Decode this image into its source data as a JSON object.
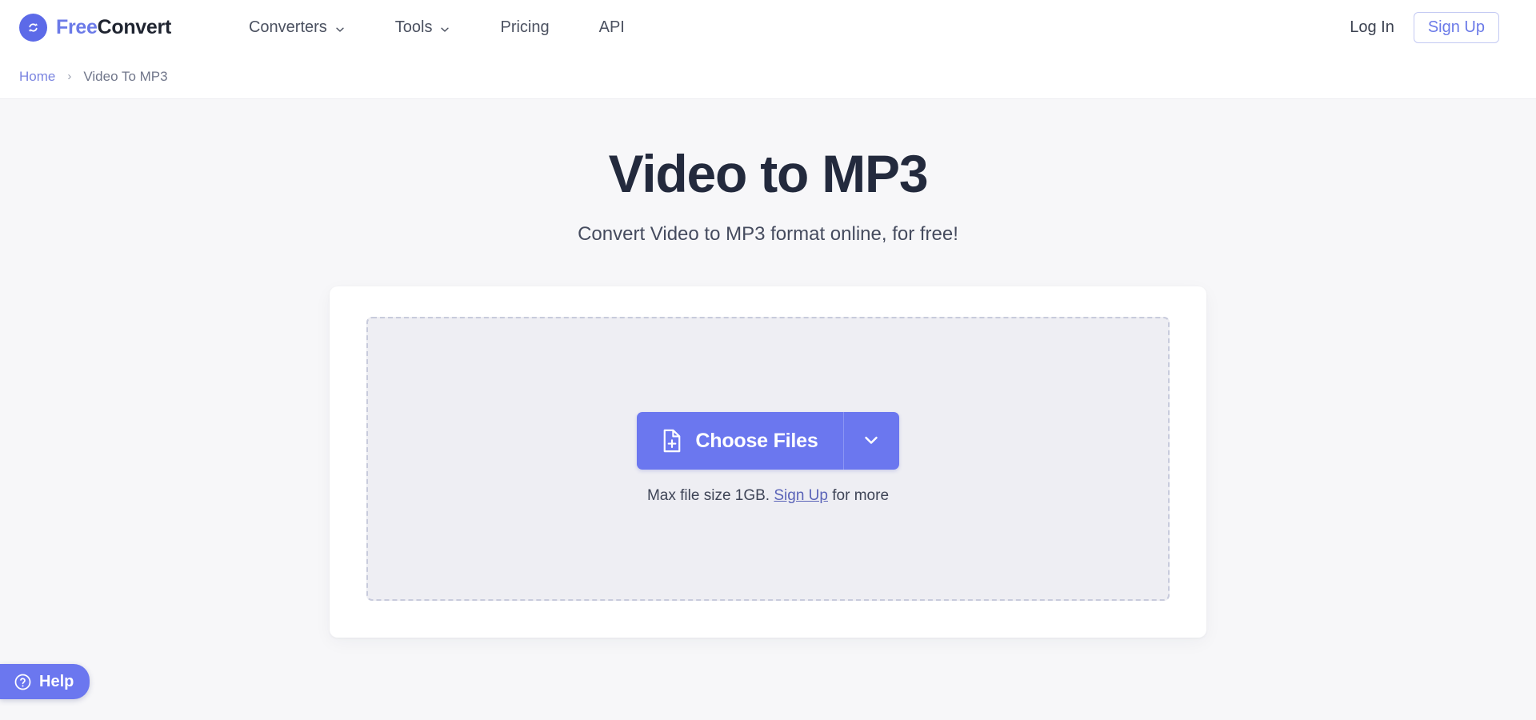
{
  "header": {
    "brand": {
      "free": "Free",
      "convert": "Convert",
      "logo_icon": "refresh-circle-icon"
    },
    "nav": [
      {
        "label": "Converters",
        "has_dropdown": true,
        "icon": "chevron-down-icon"
      },
      {
        "label": "Tools",
        "has_dropdown": true,
        "icon": "chevron-down-icon"
      },
      {
        "label": "Pricing",
        "has_dropdown": false
      },
      {
        "label": "API",
        "has_dropdown": false
      }
    ],
    "login_label": "Log In",
    "signup_label": "Sign Up"
  },
  "breadcrumb": {
    "home": "Home",
    "separator": "›",
    "current": "Video To MP3"
  },
  "main": {
    "title": "Video to MP3",
    "subtitle": "Convert Video to MP3 format online, for free!",
    "dropzone": {
      "choose_files_label": "Choose Files",
      "file_icon": "file-plus-icon",
      "caret_icon": "chevron-down-icon",
      "maxsize_prefix": "Max file size 1GB.",
      "maxsize_link": "Sign Up",
      "maxsize_suffix": "for more"
    }
  },
  "help": {
    "label": "Help",
    "icon": "question-circle-icon"
  },
  "colors": {
    "accent": "#6b77ef",
    "brand_free": "#6b7ae8",
    "brand_convert": "#1f2430",
    "title": "#232a3d",
    "page_bg": "#f7f7f9",
    "card_bg": "#ffffff",
    "dropzone_bg": "#eeeef3",
    "dropzone_border": "#c8cbdc"
  }
}
